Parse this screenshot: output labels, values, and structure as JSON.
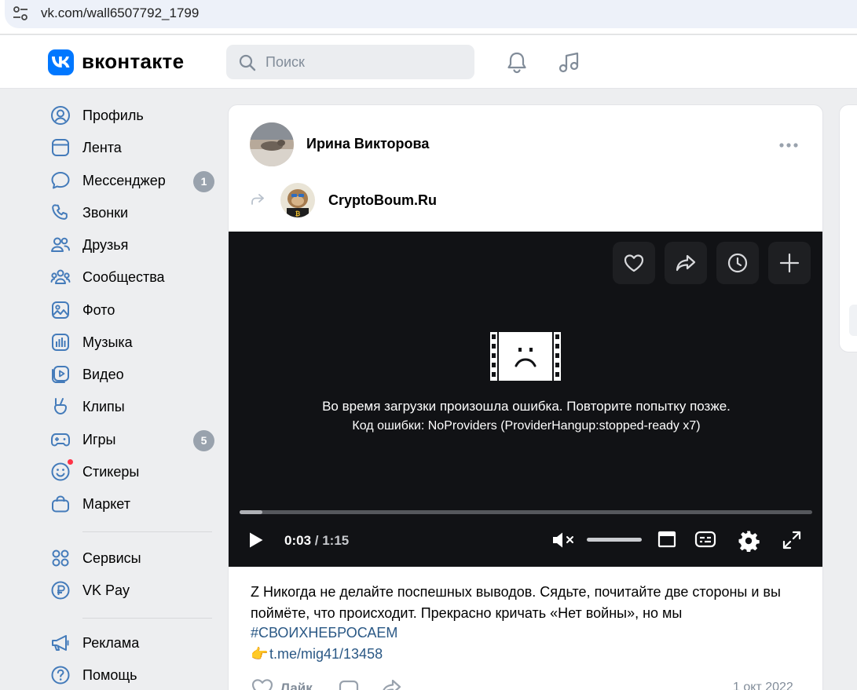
{
  "browser": {
    "url": "vk.com/wall6507792_1799"
  },
  "header": {
    "brand": "вконтакте",
    "search_placeholder": "Поиск",
    "icons": [
      "bell-icon",
      "music-icon"
    ]
  },
  "sidebar": {
    "items": [
      {
        "label": "Профиль",
        "icon": "profile-icon"
      },
      {
        "label": "Лента",
        "icon": "feed-icon"
      },
      {
        "label": "Мессенджер",
        "icon": "messenger-icon",
        "badge": "1"
      },
      {
        "label": "Звонки",
        "icon": "phone-icon"
      },
      {
        "label": "Друзья",
        "icon": "friends-icon"
      },
      {
        "label": "Сообщества",
        "icon": "communities-icon"
      },
      {
        "label": "Фото",
        "icon": "photo-icon"
      },
      {
        "label": "Музыка",
        "icon": "music-chart-icon"
      },
      {
        "label": "Видео",
        "icon": "video-icon"
      },
      {
        "label": "Клипы",
        "icon": "clips-icon"
      },
      {
        "label": "Игры",
        "icon": "gamepad-icon",
        "badge": "5"
      },
      {
        "label": "Стикеры",
        "icon": "smile-icon"
      },
      {
        "label": "Маркет",
        "icon": "bag-icon"
      },
      {
        "label": "Сервисы",
        "icon": "grid-icon"
      },
      {
        "label": "VK Pay",
        "icon": "ruble-icon"
      },
      {
        "label": "Реклама",
        "icon": "megaphone-icon"
      },
      {
        "label": "Помощь",
        "icon": "help-icon"
      }
    ]
  },
  "post": {
    "author": "Ирина Викторова",
    "repost_source": "CryptoBoum.Ru",
    "video": {
      "error_message": "Во время загрузки произошла ошибка. Повторите попытку позже.",
      "error_code": "Код ошибки: NoProviders (ProviderHangup:stopped-ready x7)",
      "current_time": "0:03",
      "separator": " / ",
      "duration": "1:15",
      "progress": 0.04,
      "volume": 1.0,
      "muted": true
    },
    "text": "Z Никогда не делайте поспешных выводов. Сядьте, почитайте две стороны и вы поймёте, что происходит. Прекрасно кричать «Нет войны», но мы",
    "hashtag": "#СВОИХНЕБРОСАЕМ",
    "link_emoji": "👉",
    "link": "t.me/mig41/13458",
    "like_label": "Лайк",
    "date": "1 окт 2022"
  },
  "colors": {
    "accent": "#0077ff",
    "link": "#2a5885",
    "badge": "#99a2ad",
    "background": "#edeef0"
  }
}
